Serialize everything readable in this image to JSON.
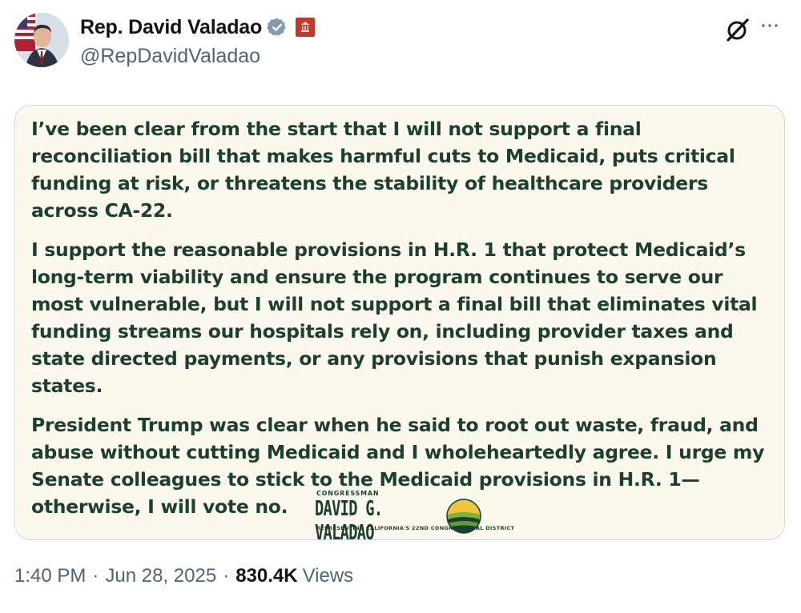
{
  "author": {
    "display_name": "Rep. David Valadao",
    "handle": "@RepDavidValadao",
    "icons": [
      "avatar",
      "verified-badge-icon",
      "government-affiliation-icon"
    ]
  },
  "header_actions": {
    "icons": [
      "grok-icon",
      "more-options-icon"
    ],
    "more_glyph": "···"
  },
  "statement": {
    "paragraphs": [
      "I’ve been clear from the start that I will not support a final reconciliation bill that makes harmful cuts to Medicaid, puts critical funding at risk, or threatens the stability of healthcare providers across CA-22.",
      "I support the reasonable provisions in H.R. 1 that protect Medicaid’s long-term viability and ensure the program continues to serve our most vulnerable, but I will not support a final bill that eliminates vital funding streams our hospitals rely on, including provider taxes and state directed payments, or any provisions that punish expansion states.",
      "President Trump was clear when he said to root out waste, fraud, and abuse without cutting Medicaid and I wholeheartedly agree. I urge my Senate colleagues to stick to the Medicaid provisions in H.R. 1—otherwise, I will vote no."
    ],
    "logo": {
      "small_text": "CONGRESSMAN",
      "name_text": "DAVID G. VALADAO",
      "sub_text": "REPRESENTING CALIFORNIA'S 22ND CONGRESSIONAL DISTRICT"
    },
    "colors": {
      "text": "#1d3f2e",
      "background": "#fbf9ee"
    }
  },
  "meta": {
    "time": "1:40 PM",
    "separator": "·",
    "date": "Jun 28, 2025",
    "views_count": "830.4K",
    "views_label": "Views"
  }
}
